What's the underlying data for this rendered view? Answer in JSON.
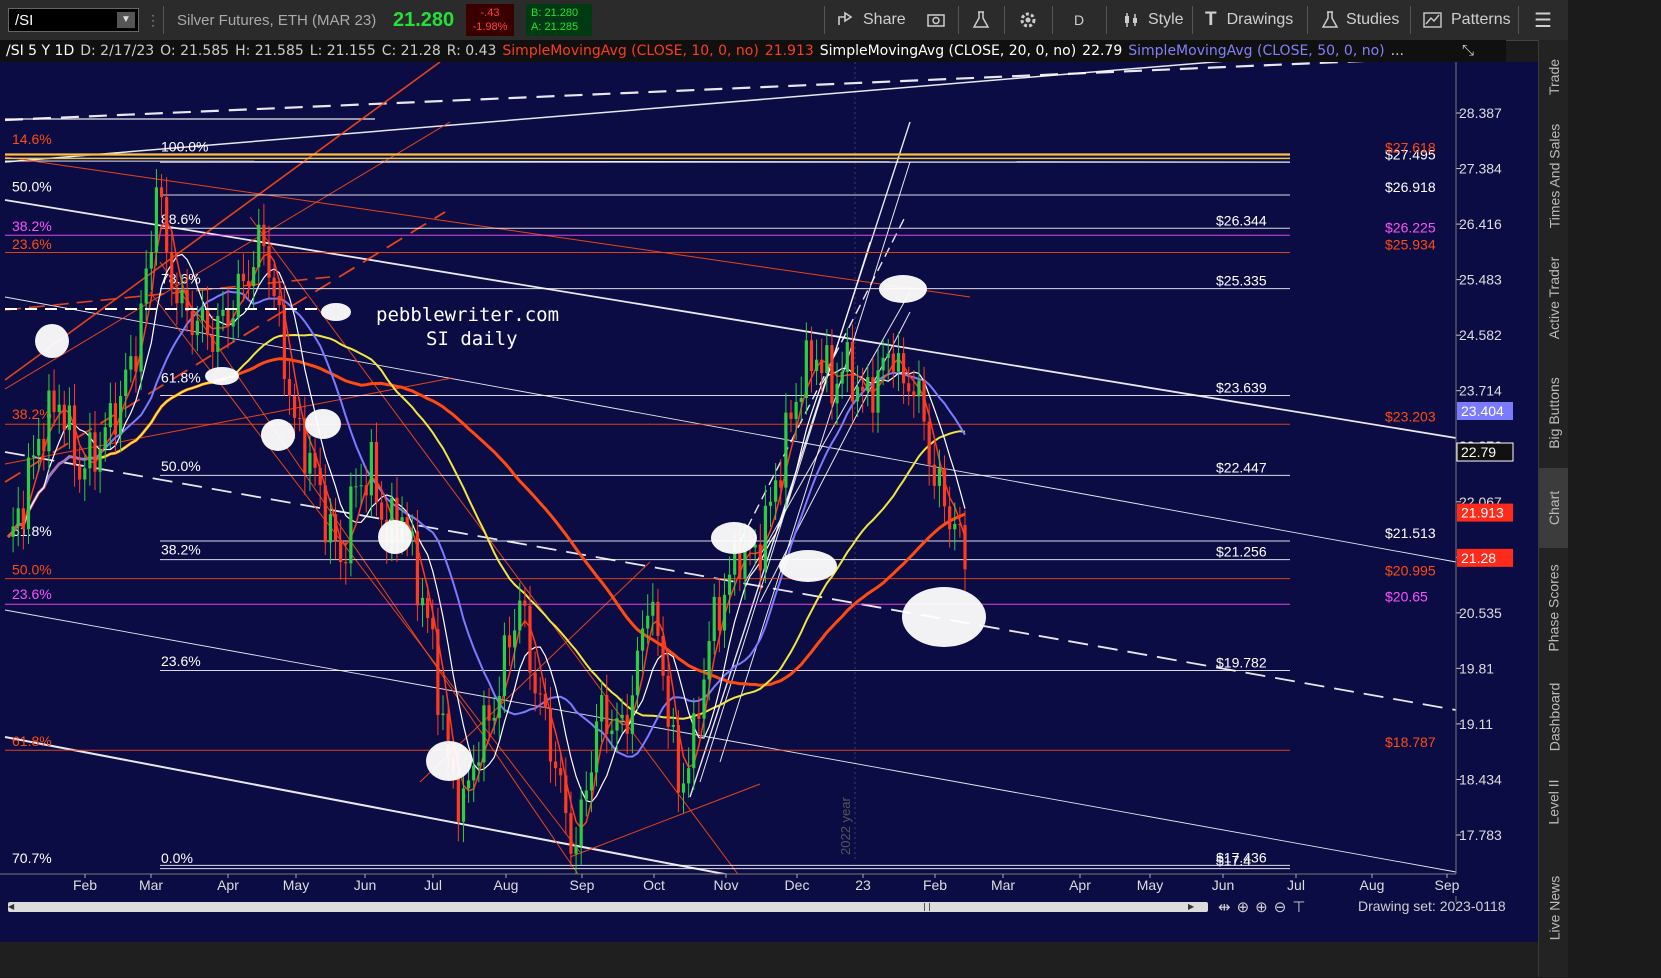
{
  "toolbar": {
    "symbol": "/SI",
    "instrument": "Silver Futures, ETH (MAR 23)",
    "last": "21.280",
    "change": "-.43",
    "change_pct": "-1.98%",
    "bid": "B: 21.280",
    "ask": "A: 21.285",
    "share": "Share",
    "period": "D",
    "style": "Style",
    "drawings": "Drawings",
    "studies": "Studies",
    "patterns": "Patterns"
  },
  "infobar": {
    "symbol_period": "/SI 5 Y 1D",
    "date": "D: 2/17/23",
    "open": "O: 21.585",
    "high": "H: 21.585",
    "low": "L: 21.155",
    "close": "C: 21.28",
    "range": "R: 0.43",
    "sma10_label": "SimpleMovingAvg (CLOSE, 10, 0, no)",
    "sma10_value": "21.913",
    "sma20_label": "SimpleMovingAvg (CLOSE, 20, 0, no)",
    "sma20_value": "22.79",
    "sma50_label": "SimpleMovingAvg (CLOSE, 50, 0, no)",
    "more": "..."
  },
  "side_tabs": [
    "Trade",
    "Times And Sales",
    "Active Trader",
    "Big Buttons",
    "Chart",
    "Phase Scores",
    "Dashboard",
    "Level II",
    "Live News"
  ],
  "footer": {
    "drawing_set": "Drawing set: 2023-0118"
  },
  "colors": {
    "background": "#0c0c45",
    "up": "#2ecc40",
    "down": "#ff3b1f",
    "sma10": "#ff3b1f",
    "sma20": "#ffffff",
    "sma50": "#7b7bff",
    "sma200": "#ff4a12",
    "sma100": "#f0e640",
    "fib_white": "#ffffff",
    "fib_red": "#ff4a12",
    "fib_magenta": "#ff50ff",
    "gold": "#e8c84a",
    "watermark": "#ffffff"
  },
  "watermark": {
    "line1": "pebblewriter.com",
    "line2": "SI daily"
  },
  "chart_data": {
    "type": "candlestick",
    "title": "",
    "x_axis_months": [
      "Feb",
      "Mar",
      "Apr",
      "May",
      "Jun",
      "Jul",
      "Aug",
      "Sep",
      "Oct",
      "Nov",
      "Dec",
      "23",
      "Feb",
      "Mar",
      "Apr",
      "May",
      "Jun",
      "Jul",
      "Aug",
      "Sep"
    ],
    "year_marker": "2022 year",
    "y_ticks": [
      28.387,
      27.384,
      26.416,
      25.483,
      24.582,
      23.714,
      22.876,
      22.067,
      21.288,
      20.535,
      19.81,
      19.11,
      18.434,
      17.783
    ],
    "y_tick_labels": [
      "28.387",
      "27.384",
      "26.416",
      "25.483",
      "24.582",
      "23.714",
      "22.876",
      "22.067",
      "21.288",
      "20.535",
      "19.81",
      "19.11",
      "18.434",
      "17.783"
    ],
    "scale": "log",
    "ylim": [
      17.2,
      29.3
    ],
    "price_badges": [
      {
        "label": "23.404",
        "value": 23.404,
        "kind": "sma50"
      },
      {
        "label": "22.79",
        "value": 22.79,
        "kind": "sma20"
      },
      {
        "label": "21.913",
        "value": 21.913,
        "kind": "sma10"
      },
      {
        "label": "21.28",
        "value": 21.28,
        "kind": "last"
      }
    ],
    "level_lines": [
      {
        "label": "$27.495",
        "value": 27.495,
        "color": "white"
      },
      {
        "label": "$27.618",
        "value": 27.618,
        "color": "red"
      },
      {
        "label": "$26.918",
        "value": 26.918,
        "color": "white"
      },
      {
        "label": "$26.344",
        "value": 26.344,
        "color": "white"
      },
      {
        "label": "$26.225",
        "value": 26.225,
        "color": "magenta"
      },
      {
        "label": "$25.934",
        "value": 25.934,
        "color": "red"
      },
      {
        "label": "$25.335",
        "value": 25.335,
        "color": "white"
      },
      {
        "label": "$23.639",
        "value": 23.639,
        "color": "white"
      },
      {
        "label": "$23.203",
        "value": 23.203,
        "color": "red"
      },
      {
        "label": "$22.447",
        "value": 22.447,
        "color": "white"
      },
      {
        "label": "$21.513",
        "value": 21.513,
        "color": "white"
      },
      {
        "label": "$21.256",
        "value": 21.256,
        "color": "white"
      },
      {
        "label": "$20.995",
        "value": 20.995,
        "color": "red"
      },
      {
        "label": "$20.65",
        "value": 20.65,
        "color": "magenta"
      },
      {
        "label": "$19.782",
        "value": 19.782,
        "color": "white"
      },
      {
        "label": "$18.787",
        "value": 18.787,
        "color": "red"
      },
      {
        "label": "$17.4",
        "value": 17.4,
        "color": "white"
      },
      {
        "label": "$17.436",
        "value": 17.436,
        "color": "white"
      }
    ],
    "fib_labels": [
      {
        "label": "14.6%",
        "value": 27.75,
        "color": "red",
        "col": "left"
      },
      {
        "label": "100.0%",
        "value": 27.62,
        "color": "white",
        "col": "mid"
      },
      {
        "label": "50.0%",
        "value": 26.91,
        "color": "white",
        "col": "left"
      },
      {
        "label": "88.6%",
        "value": 26.35,
        "color": "white",
        "col": "mid"
      },
      {
        "label": "38.2%",
        "value": 26.23,
        "color": "magenta",
        "col": "left"
      },
      {
        "label": "23.6%",
        "value": 25.93,
        "color": "red",
        "col": "left"
      },
      {
        "label": "78.6%",
        "value": 25.35,
        "color": "white",
        "col": "mid"
      },
      {
        "label": "61.8%",
        "value": 23.78,
        "color": "white",
        "col": "mid"
      },
      {
        "label": "38.2%",
        "value": 23.22,
        "color": "red",
        "col": "left"
      },
      {
        "label": "50.0%",
        "value": 22.45,
        "color": "white",
        "col": "mid"
      },
      {
        "label": "61.8%",
        "value": 21.53,
        "color": "white",
        "col": "left"
      },
      {
        "label": "38.2%",
        "value": 21.27,
        "color": "white",
        "col": "mid"
      },
      {
        "label": "50.0%",
        "value": 21.0,
        "color": "red",
        "col": "left"
      },
      {
        "label": "23.6%",
        "value": 20.67,
        "color": "magenta",
        "col": "left"
      },
      {
        "label": "23.6%",
        "value": 19.79,
        "color": "white",
        "col": "mid"
      },
      {
        "label": "61.8%",
        "value": 18.79,
        "color": "red",
        "col": "left"
      },
      {
        "label": "70.7%",
        "value": 17.42,
        "color": "white",
        "col": "left"
      },
      {
        "label": "0.0%",
        "value": 17.42,
        "color": "white",
        "col": "mid"
      }
    ],
    "price_path": [
      [
        0,
        21.4
      ],
      [
        3,
        22.1
      ],
      [
        6,
        23.0
      ],
      [
        10,
        23.6
      ],
      [
        14,
        22.5
      ],
      [
        18,
        22.9
      ],
      [
        22,
        23.6
      ],
      [
        25,
        24.4
      ],
      [
        28,
        26.0
      ],
      [
        29,
        27.4
      ],
      [
        31,
        25.8
      ],
      [
        34,
        25.0
      ],
      [
        37,
        24.8
      ],
      [
        40,
        24.6
      ],
      [
        43,
        24.9
      ],
      [
        47,
        25.6
      ],
      [
        50,
        26.2
      ],
      [
        53,
        24.7
      ],
      [
        56,
        23.2
      ],
      [
        59,
        22.7
      ],
      [
        62,
        21.9
      ],
      [
        65,
        21.2
      ],
      [
        68,
        22.3
      ],
      [
        71,
        22.5
      ],
      [
        74,
        21.6
      ],
      [
        77,
        21.9
      ],
      [
        80,
        21.0
      ],
      [
        83,
        20.1
      ],
      [
        86,
        18.6
      ],
      [
        89,
        18.1
      ],
      [
        92,
        18.9
      ],
      [
        95,
        19.3
      ],
      [
        98,
        20.2
      ],
      [
        100,
        20.7
      ],
      [
        103,
        19.6
      ],
      [
        106,
        18.9
      ],
      [
        109,
        18.0
      ],
      [
        111,
        17.6
      ],
      [
        113,
        18.4
      ],
      [
        116,
        19.3
      ],
      [
        119,
        19.0
      ],
      [
        122,
        19.4
      ],
      [
        125,
        20.8
      ],
      [
        128,
        19.8
      ],
      [
        131,
        18.3
      ],
      [
        134,
        18.9
      ],
      [
        137,
        20.2
      ],
      [
        140,
        20.8
      ],
      [
        143,
        21.4
      ],
      [
        146,
        21.3
      ],
      [
        149,
        22.0
      ],
      [
        152,
        23.0
      ],
      [
        155,
        23.9
      ],
      [
        158,
        24.3
      ],
      [
        161,
        23.8
      ],
      [
        164,
        24.1
      ],
      [
        167,
        23.6
      ],
      [
        170,
        23.9
      ],
      [
        173,
        24.4
      ],
      [
        175,
        23.7
      ],
      [
        177,
        23.9
      ],
      [
        179,
        23.2
      ],
      [
        181,
        22.4
      ],
      [
        184,
        21.9
      ],
      [
        187,
        21.28
      ]
    ],
    "x_date_span": "2022-01 to 2023-02-17 (daily)"
  }
}
